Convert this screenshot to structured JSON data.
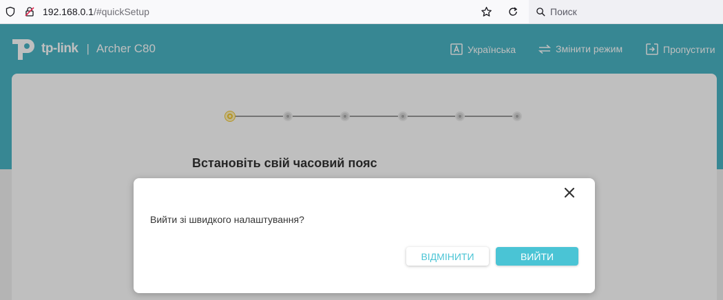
{
  "browser": {
    "url_host": "192.168.0.1",
    "url_path": "/#quickSetup",
    "search_placeholder": "Поиск"
  },
  "header": {
    "brand": "tp-link",
    "separator": "|",
    "model": "Archer C80",
    "menu": [
      {
        "label": "Українська",
        "icon": "language-icon"
      },
      {
        "label": "Змінити режим",
        "icon": "switch-mode-icon"
      },
      {
        "label": "Пропустити",
        "icon": "skip-icon"
      }
    ]
  },
  "wizard": {
    "steps_total": 6,
    "current_step": 1,
    "title": "Встановіть свій часовий пояс"
  },
  "dialog": {
    "message": "Вийти зі швидкого налаштування?",
    "cancel_label": "ВІДМІНИТИ",
    "confirm_label": "ВИЙТИ"
  },
  "colors": {
    "header": "#4ab5c4",
    "accent": "#4ac4d5",
    "active_step": "#f2c62e"
  }
}
